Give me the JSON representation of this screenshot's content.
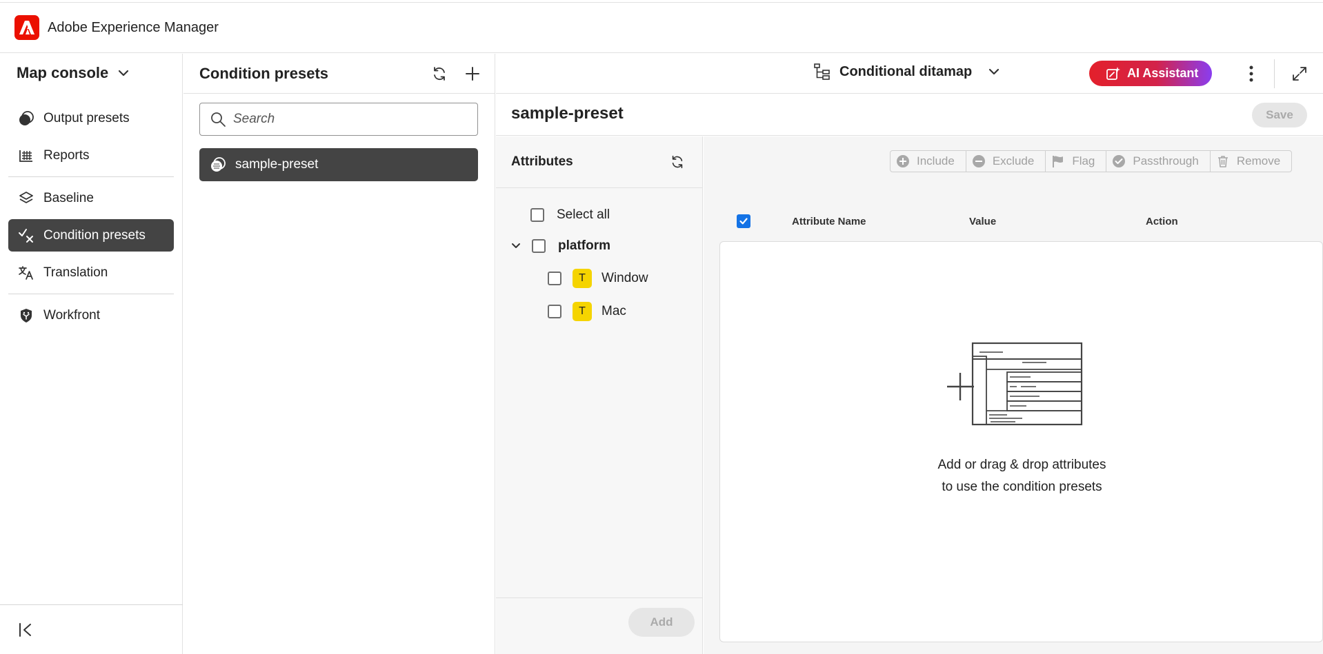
{
  "app": {
    "title": "Adobe Experience Manager",
    "logo_icon": "adobe-logo-icon",
    "brand_color": "#eb1000"
  },
  "leftnav": {
    "console_label": "Map console",
    "items": [
      {
        "label": "Output presets",
        "icon": "output-presets-icon",
        "active": false
      },
      {
        "label": "Reports",
        "icon": "reports-icon",
        "active": false
      },
      {
        "label": "Baseline",
        "icon": "baseline-icon",
        "active": false
      },
      {
        "label": "Condition presets",
        "icon": "condition-presets-icon",
        "active": true
      },
      {
        "label": "Translation",
        "icon": "translation-icon",
        "active": false
      },
      {
        "label": "Workfront",
        "icon": "workfront-icon",
        "active": false
      }
    ],
    "collapse_icon": "collapse-panel-icon"
  },
  "presets": {
    "title": "Condition presets",
    "search_placeholder": "Search",
    "items": [
      {
        "label": "sample-preset",
        "selected": true
      }
    ]
  },
  "toolbar": {
    "ditamap_label": "Conditional ditamap",
    "ai_label": "AI Assistant",
    "ai_gradient": [
      "#e3202b",
      "#8a3df0"
    ]
  },
  "editor": {
    "title": "sample-preset",
    "save_label": "Save"
  },
  "attributes": {
    "title": "Attributes",
    "select_all": "Select all",
    "groups": [
      {
        "label": "platform",
        "expanded": true,
        "values": [
          {
            "badge": "T",
            "label": "Window"
          },
          {
            "badge": "T",
            "label": "Mac"
          }
        ]
      }
    ],
    "add_label": "Add",
    "badge_color": "#f5d400"
  },
  "actions": {
    "include": "Include",
    "exclude": "Exclude",
    "flag": "Flag",
    "passthrough": "Passthrough",
    "remove": "Remove"
  },
  "table": {
    "columns": [
      "Attribute Name",
      "Value",
      "Action"
    ],
    "header_checked": true,
    "rows": [],
    "empty_line1": "Add or drag & drop attributes",
    "empty_line2": "to use the condition presets",
    "accent": "#1473e6"
  }
}
